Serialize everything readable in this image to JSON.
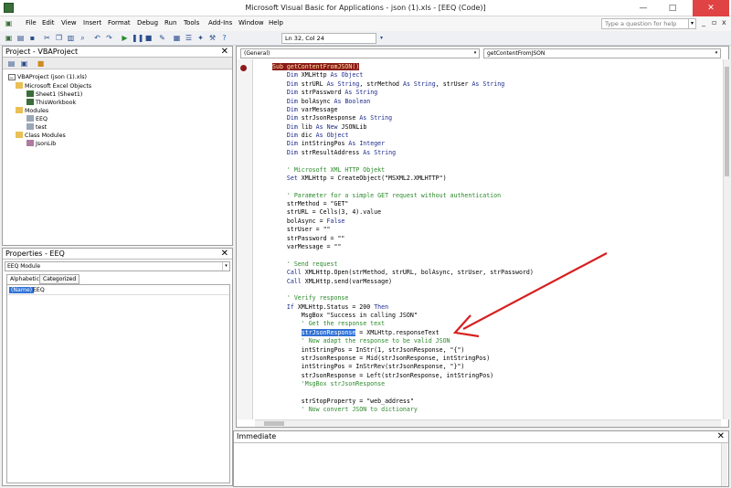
{
  "window": {
    "title": "Microsoft Visual Basic for Applications - json (1).xls - [EEQ (Code)]",
    "minimize": "—",
    "maximize": "□",
    "close": "✕"
  },
  "menu": {
    "items": [
      "File",
      "Edit",
      "View",
      "Insert",
      "Format",
      "Debug",
      "Run",
      "Tools",
      "Add-Ins",
      "Window",
      "Help"
    ],
    "search_placeholder": "Type a question for help",
    "mdi_min": "_",
    "mdi_restore": "▫",
    "mdi_close": "x"
  },
  "toolbar": {
    "position": "Ln 32, Col 24"
  },
  "project_pane": {
    "title": "Project - VBAProject",
    "tree": [
      "VBAProject (json (1).xls)",
      "Microsoft Excel Objects",
      "Sheet1 (Sheet1)",
      "ThisWorkbook",
      "Modules",
      "EEQ",
      "test",
      "Class Modules",
      "JsonLib"
    ]
  },
  "properties_pane": {
    "title": "Properties - EEQ",
    "object": "EEQ  Module",
    "tabs": [
      "Alphabetic",
      "Categorized"
    ],
    "prop_name": "(Name)",
    "prop_value": "EEQ"
  },
  "code_window": {
    "object_combo": "(General)",
    "proc_combo": "getContentFromJSON",
    "lines": [
      "Sub getContentFromJSON()",
      "    Dim XMLHttp As Object",
      "    Dim strURL As String, strMethod As String, strUser As String",
      "    Dim strPassword As String",
      "    Dim bolAsync As Boolean",
      "    Dim varMessage",
      "    Dim strJsonResponse As String",
      "    Dim lib As New JSONLib",
      "    Dim dic As Object",
      "    Dim intStringPos As Integer",
      "    Dim strResultAddress As String",
      "",
      "    ' Microsoft XML HTTP Objekt",
      "    Set XMLHttp = CreateObject(\"MSXML2.XMLHTTP\")",
      "",
      "    ' Parameter for a simple GET request without authentication",
      "    strMethod = \"GET\"",
      "    strURL = Cells(3, 4).value",
      "    bolAsync = False",
      "    strUser = \"\"",
      "    strPassword = \"\"",
      "    varMessage = \"\"",
      "",
      "    ' Send request",
      "    Call XMLHttp.Open(strMethod, strURL, bolAsync, strUser, strPassword)",
      "    Call XMLHttp.send(varMessage)",
      "",
      "    ' Verify response",
      "    If XMLHttp.Status = 200 Then",
      "        MsgBox \"Success in calling JSON\"",
      "        ' Get the response text",
      "        strJsonResponse = XMLHttp.responseText",
      "        ' Now adapt the response to be valid JSON",
      "        intStringPos = InStr(1, strJsonResponse, \"{\")",
      "        strJsonResponse = Mid(strJsonResponse, intStringPos)",
      "        intStringPos = InStrRev(strJsonResponse, \"}\")",
      "        strJsonResponse = Left(strJsonResponse, intStringPos)",
      "        'MsgBox strJsonResponse",
      "",
      "        strStopProperty = \"web_address\"",
      "        ' Now convert JSON to dictionary"
    ]
  },
  "immediate_pane": {
    "title": "Immediate"
  },
  "colors": {
    "keyword": "#1c2b8c",
    "comment": "#2c8a2c",
    "annotation_arrow": "#d62020",
    "selection": "#3072d6",
    "breakpoint": "#8b1a1a"
  }
}
